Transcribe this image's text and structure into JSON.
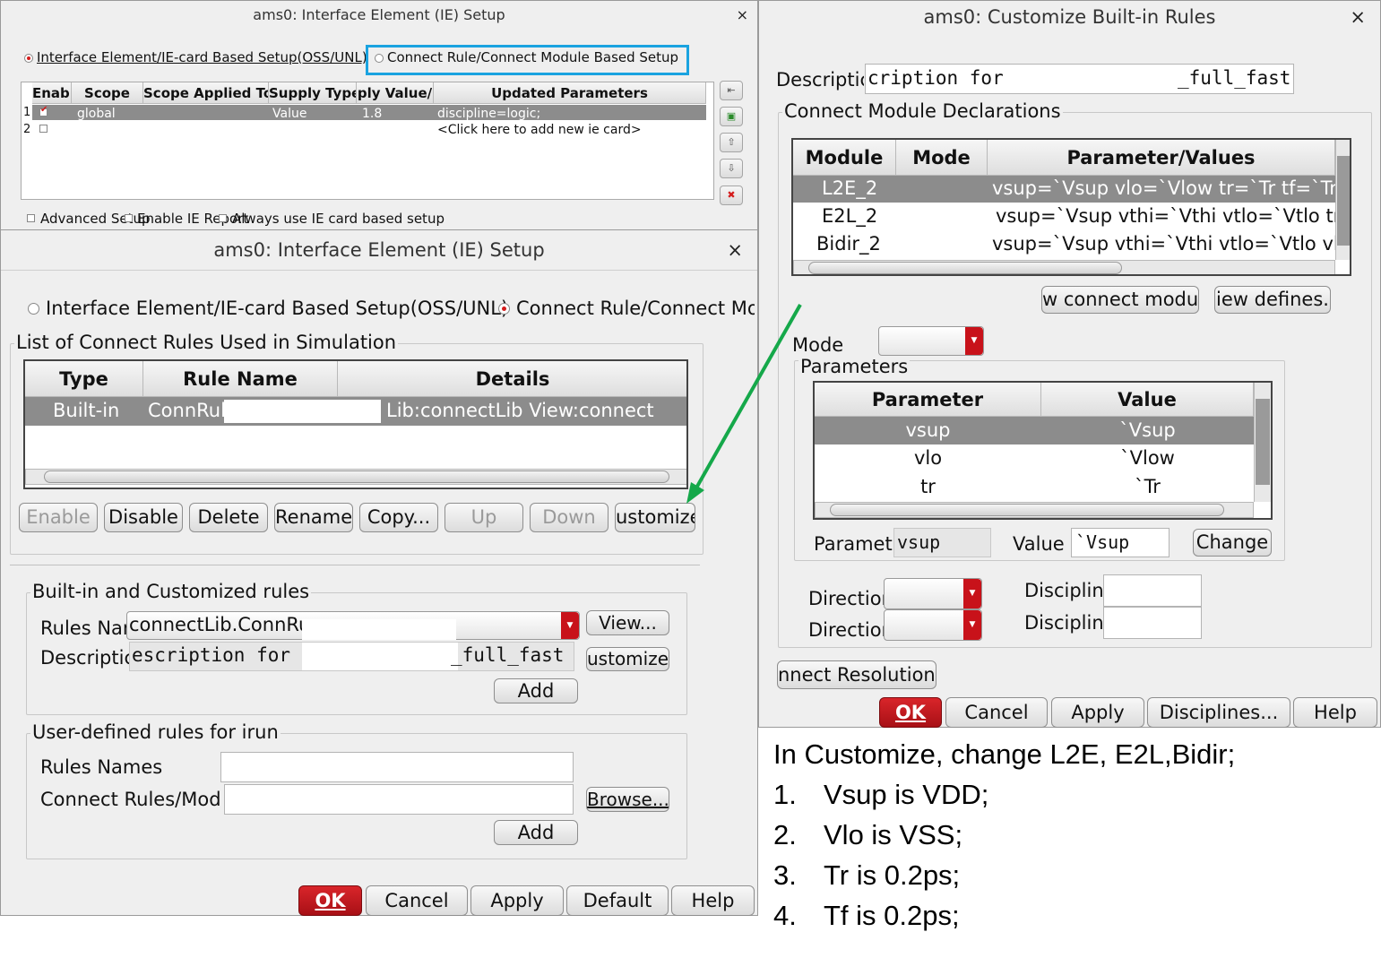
{
  "back_window": {
    "title": "ams0: Interface Element (IE) Setup",
    "radio_ie": "Interface Element/IE-card Based Setup(OSS/UNL)",
    "radio_cr": "Connect Rule/Connect Module Based Setup",
    "columns": [
      "Enabl",
      "Scope",
      "Scope Applied To",
      "Supply Type",
      "ply Value/",
      "Updated Parameters"
    ],
    "rows": [
      {
        "num": "1",
        "enabled": true,
        "scope": "global",
        "applied": "",
        "supply_type": "Value",
        "supply_value": "1.8",
        "params": "discipline=logic;"
      },
      {
        "num": "2",
        "enabled": false,
        "scope": "",
        "applied": "",
        "supply_type": "",
        "supply_value": "",
        "params": "<Click here to add new ie card>"
      }
    ],
    "adv_setup": "Advanced Setup",
    "enable_ie": "Enable IE Report",
    "always_ie": "Always use IE card based setup",
    "highlight_color": "#1aa3e0"
  },
  "main_window": {
    "title": "ams0: Interface Element (IE) Setup",
    "radio_ie": "Interface Element/IE-card Based Setup(OSS/UNL)",
    "radio_cr": "Connect Rule/Connect Module Based Setup",
    "rules_group": "List of Connect Rules Used in Simulation",
    "rules_columns": [
      "Type",
      "Rule Name",
      "Details"
    ],
    "rules_row": {
      "type": "Built-in",
      "name": "ConnRul",
      "details": "Lib:connectLib View:connect"
    },
    "buttons": [
      "Enable",
      "Disable",
      "Delete",
      "Rename..",
      "Copy...",
      "Up",
      "Down",
      "ustomize"
    ],
    "builtin_group": "Built-in and Customized rules",
    "rules_name_label": "Rules Nar",
    "rules_name_value": "connectLib.ConnRu",
    "view_btn": "View...",
    "desc_label": "Descriptic",
    "desc_value": "escription for",
    "desc_value_end": "_full_fast",
    "customize_btn": "ustomize",
    "add_btn": "Add",
    "user_group": "User-defined rules for irun",
    "user_rules_names": "Rules Names",
    "user_connect_rules": "Connect Rules/Modu",
    "browse_btn": "Browse...",
    "add_btn2": "Add",
    "ok": "OK",
    "cancel": "Cancel",
    "apply": "Apply",
    "default": "Default",
    "help": "Help"
  },
  "customize_window": {
    "title": "ams0: Customize Built-in Rules",
    "desc_label": "Descriptic",
    "desc_value": "cription for",
    "desc_value_end": "_full_fast",
    "decl_group": "Connect Module Declarations",
    "decl_columns": [
      "Module",
      "Mode",
      "Parameter/Values"
    ],
    "decl_rows": [
      {
        "module": "L2E_2",
        "mode": "",
        "params": "vsup=`Vsup vlo=`Vlow tr=`Tr tf=`Tr rl"
      },
      {
        "module": "E2L_2",
        "mode": "",
        "params": "vsup=`Vsup vthi=`Vthi vtlo=`Vtlo tr=`"
      },
      {
        "module": "Bidir_2",
        "mode": "",
        "params": "vsup=`Vsup vthi=`Vthi vtlo=`Vtlo vlo="
      }
    ],
    "new_module_btn": "w connect modul",
    "view_defines_btn": "iew defines.",
    "mode_label": "Mode",
    "params_group": "Parameters",
    "param_columns": [
      "Parameter",
      "Value"
    ],
    "param_rows": [
      {
        "name": "vsup",
        "value": "`Vsup"
      },
      {
        "name": "vlo",
        "value": "`Vlow"
      },
      {
        "name": "tr",
        "value": "`Tr"
      }
    ],
    "param_label": "Paramet",
    "param_value": "vsup",
    "value_label": "Value",
    "value_value": "`Vsup",
    "change_btn": "Change",
    "direction_label": "Directior",
    "discipline_label": "Disciplin",
    "resolution_btn": "nnect Resolution:",
    "ok": "OK",
    "cancel": "Cancel",
    "apply": "Apply",
    "disciplines": "Disciplines...",
    "help": "Help"
  },
  "notes": [
    {
      "num": "",
      "text": "In Customize, change L2E, E2L,Bidir;"
    },
    {
      "num": "1.",
      "text": "Vsup is VDD;"
    },
    {
      "num": "2.",
      "text": "Vlo is VSS;"
    },
    {
      "num": "3.",
      "text": "Tr is 0.2ps;"
    },
    {
      "num": "4.",
      "text": "Tf is 0.2ps;"
    }
  ],
  "arrow_color": "#15a84a"
}
